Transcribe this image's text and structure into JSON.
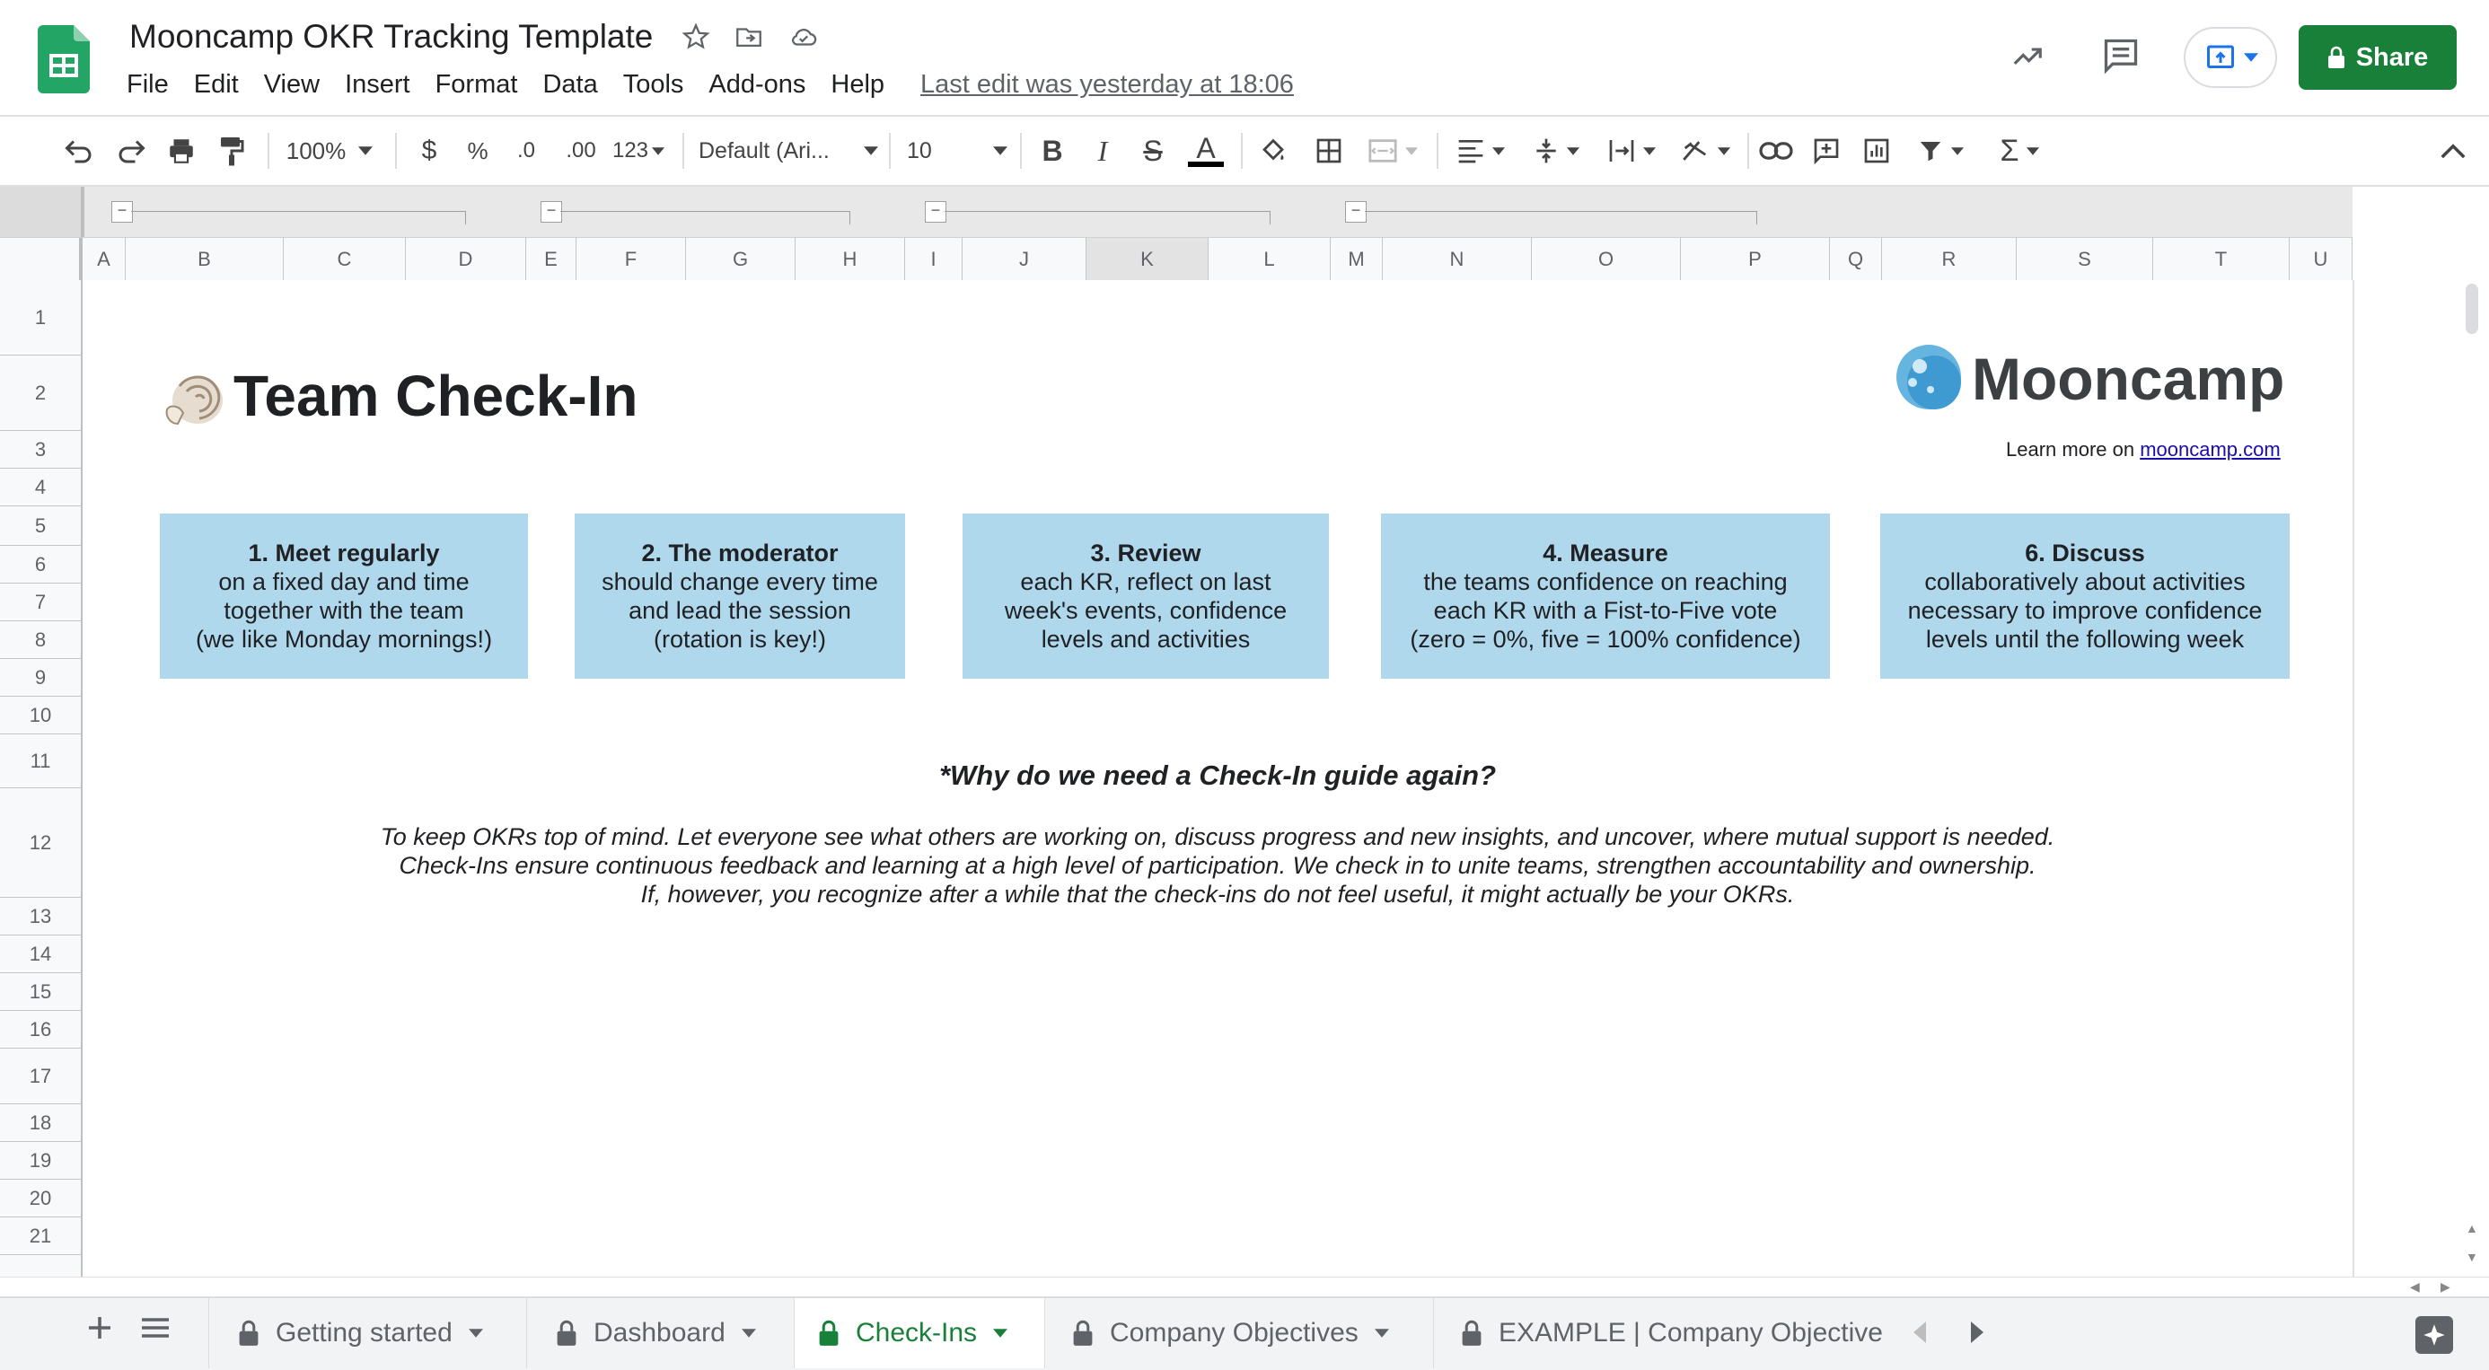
{
  "app": {
    "doc_title": "Mooncamp OKR Tracking Template",
    "last_edit": "Last edit was yesterday at 18:06",
    "share_label": "Share",
    "menu": [
      "File",
      "Edit",
      "View",
      "Insert",
      "Format",
      "Data",
      "Tools",
      "Add-ons",
      "Help"
    ]
  },
  "toolbar": {
    "zoom": "100%",
    "currency": "$",
    "percent": "%",
    "decrease_decimal": ".0",
    "increase_decimal": ".00",
    "more_formats": "123",
    "font": "Default (Ari...",
    "font_size": "10",
    "bold": "B",
    "italic": "I",
    "strikethrough": "S",
    "text_color": "A",
    "function_symbol": "Σ"
  },
  "columns": [
    "A",
    "B",
    "C",
    "D",
    "E",
    "F",
    "G",
    "H",
    "I",
    "J",
    "K",
    "L",
    "M",
    "N",
    "O",
    "P",
    "Q",
    "R",
    "S",
    "T",
    "U"
  ],
  "rows": [
    "1",
    "2",
    "3",
    "4",
    "5",
    "6",
    "7",
    "8",
    "9",
    "10",
    "11",
    "12",
    "13",
    "14",
    "15",
    "16",
    "17",
    "18",
    "19",
    "20",
    "21"
  ],
  "sheet": {
    "title": "Team Check-In",
    "logo_text": "Mooncamp",
    "learn_more_prefix": "Learn more on ",
    "learn_more_link": "mooncamp.com",
    "cards": [
      {
        "heading": "1. Meet regularly",
        "lines": [
          "on a fixed day and time",
          "together with the team",
          "(we like Monday mornings!)"
        ]
      },
      {
        "heading": "2. The moderator",
        "lines": [
          "should change every time",
          "and lead the session",
          "(rotation is key!)"
        ]
      },
      {
        "heading": "3. Review",
        "lines": [
          "each KR, reflect on last",
          "week's events, confidence",
          "levels and activities"
        ]
      },
      {
        "heading": "4. Measure",
        "lines": [
          "the teams confidence on reaching",
          "each KR with a Fist-to-Five vote",
          "(zero = 0%, five = 100% confidence)"
        ]
      },
      {
        "heading": "6. Discuss",
        "lines": [
          "collaboratively about activities",
          "necessary to improve confidence",
          "levels until the following week"
        ]
      }
    ],
    "why_heading": "*Why do we need a Check-In guide again?",
    "why_lines": [
      "To keep OKRs top of mind. Let everyone see what others are working on, discuss progress and new insights, and uncover, where mutual support is needed.",
      "Check-Ins ensure continuous feedback and learning at a high level of participation. We check in to unite teams, strengthen accountability and ownership.",
      "If, however, you recognize after a while that the check-ins do not feel useful, it might actually be your OKRs."
    ]
  },
  "tabs": [
    {
      "label": "Getting started",
      "active": false
    },
    {
      "label": "Dashboard",
      "active": false
    },
    {
      "label": "Check-Ins",
      "active": true
    },
    {
      "label": "Company Objectives",
      "active": false
    },
    {
      "label": "EXAMPLE | Company Objectives",
      "active": false
    }
  ],
  "colors": {
    "card_bg": "#b0d8ec",
    "share_bg": "#188038",
    "active_tab": "#188038",
    "link": "#1a0dab"
  }
}
